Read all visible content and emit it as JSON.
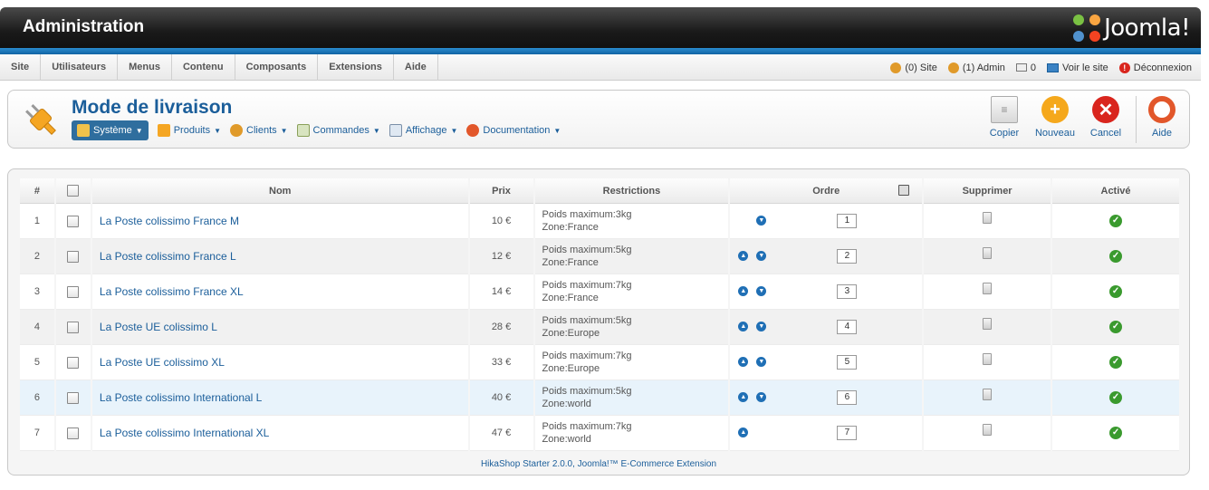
{
  "header": {
    "title": "Administration",
    "brand": "Joomla!"
  },
  "menu": {
    "items": [
      "Site",
      "Utilisateurs",
      "Menus",
      "Contenu",
      "Composants",
      "Extensions",
      "Aide"
    ],
    "status": {
      "site_users": "(0) Site",
      "admin_users": "(1) Admin",
      "messages": "0",
      "view_site": "Voir le site",
      "logout": "Déconnexion"
    }
  },
  "toolbar": {
    "title": "Mode de livraison",
    "submenu": [
      {
        "label": "Système",
        "active": true
      },
      {
        "label": "Produits"
      },
      {
        "label": "Clients"
      },
      {
        "label": "Commandes"
      },
      {
        "label": "Affichage"
      },
      {
        "label": "Documentation"
      }
    ],
    "buttons": {
      "copy": "Copier",
      "new": "Nouveau",
      "cancel": "Cancel",
      "help": "Aide"
    }
  },
  "table": {
    "headers": {
      "num": "#",
      "name": "Nom",
      "price": "Prix",
      "restrictions": "Restrictions",
      "order": "Ordre",
      "delete": "Supprimer",
      "active": "Activé"
    },
    "rows": [
      {
        "num": "1",
        "name": "La Poste colissimo France M",
        "price": "10 €",
        "weight": "Poids maximum:3kg",
        "zone": "Zone:France",
        "order": "1"
      },
      {
        "num": "2",
        "name": "La Poste colissimo France L",
        "price": "12 €",
        "weight": "Poids maximum:5kg",
        "zone": "Zone:France",
        "order": "2"
      },
      {
        "num": "3",
        "name": "La Poste colissimo France XL",
        "price": "14 €",
        "weight": "Poids maximum:7kg",
        "zone": "Zone:France",
        "order": "3"
      },
      {
        "num": "4",
        "name": "La Poste UE colissimo L",
        "price": "28 €",
        "weight": "Poids maximum:5kg",
        "zone": "Zone:Europe",
        "order": "4"
      },
      {
        "num": "5",
        "name": "La Poste UE colissimo XL",
        "price": "33 €",
        "weight": "Poids maximum:7kg",
        "zone": "Zone:Europe",
        "order": "5"
      },
      {
        "num": "6",
        "name": "La Poste colissimo International L",
        "price": "40 €",
        "weight": "Poids maximum:5kg",
        "zone": "Zone:world",
        "order": "6"
      },
      {
        "num": "7",
        "name": "La Poste colissimo International XL",
        "price": "47 €",
        "weight": "Poids maximum:7kg",
        "zone": "Zone:world",
        "order": "7"
      }
    ]
  },
  "footer": "HikaShop Starter 2.0.0, Joomla!™ E-Commerce Extension"
}
